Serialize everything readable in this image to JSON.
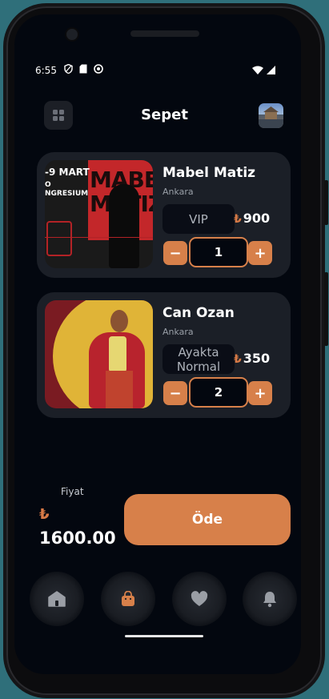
{
  "status_bar": {
    "time": "6:55"
  },
  "header": {
    "title": "Sepet"
  },
  "cart": [
    {
      "name": "Mabel Matiz",
      "city": "Ankara",
      "ticket_type": "VIP",
      "price": "900",
      "quantity": "1",
      "poster_text": {
        "date": "-9 MART",
        "sub": "O\nNGRESIUM",
        "big": "MABEL\nMATIZ"
      }
    },
    {
      "name": "Can Ozan",
      "city": "Ankara",
      "ticket_type": "Ayakta Normal",
      "price": "350",
      "quantity": "2"
    }
  ],
  "summary": {
    "label": "Fiyat",
    "currency": "₺",
    "total": "1600.00"
  },
  "pay_button": {
    "label": "Öde"
  },
  "nav": [
    "home-icon",
    "bag-icon",
    "heart-icon",
    "bell-icon"
  ],
  "colors": {
    "accent": "#d7804a",
    "background": "#03070f",
    "card": "#1b1f27"
  }
}
